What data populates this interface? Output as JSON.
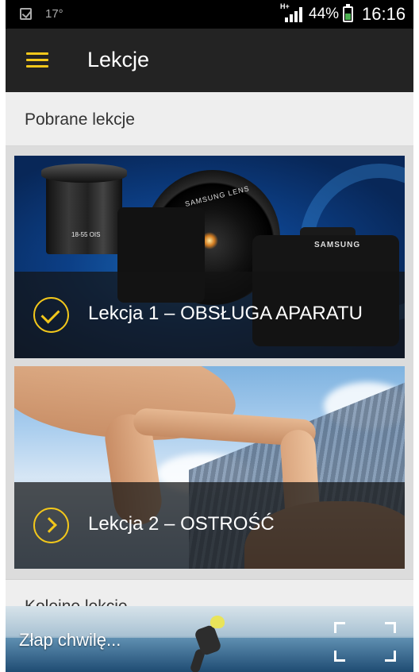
{
  "status_bar": {
    "temperature": "17°",
    "network": "H+",
    "battery_percent": "44%",
    "time": "16:16"
  },
  "toolbar": {
    "title": "Lekcje",
    "menu_icon": "hamburger-menu-icon",
    "accent_color": "#f2c71b"
  },
  "downloaded_section": {
    "title": "Pobrane lekcje"
  },
  "lessons": [
    {
      "title": "Lekcja 1 – OBSŁUGA APARATU",
      "status_icon": "check-circle-icon",
      "completed": true
    },
    {
      "title": "Lekcja 2 – OSTROŚĆ",
      "status_icon": "chevron-right-circle-icon",
      "completed": false
    }
  ],
  "card1_art": {
    "lens_text": "SAMSUNG LENS",
    "brand": "SAMSUNG",
    "lens_label": "18-55 OIS"
  },
  "next_section": {
    "title": "Kolejne lekcje"
  },
  "banner": {
    "text": "Złap chwilę...",
    "fullscreen_icon": "fullscreen-icon"
  }
}
